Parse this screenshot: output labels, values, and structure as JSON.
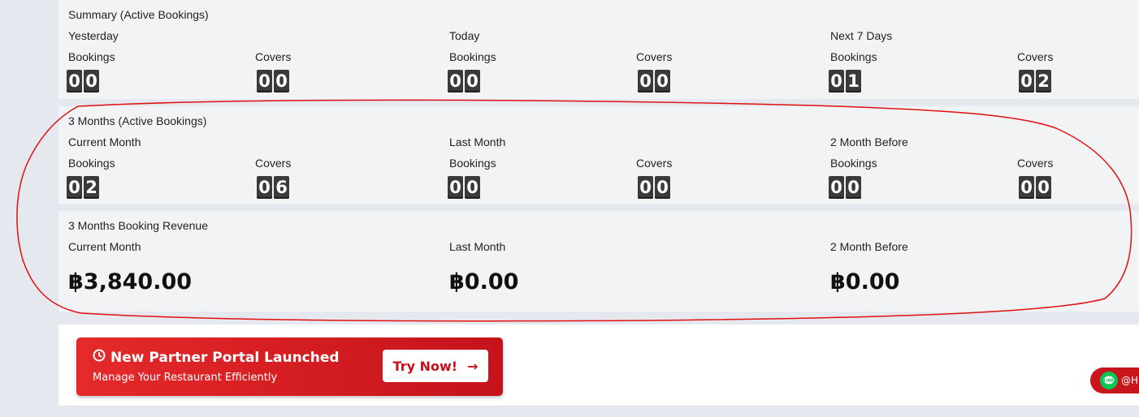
{
  "summary": {
    "title": "Summary (Active Bookings)",
    "groups": [
      {
        "label": "Yesterday",
        "bookings_label": "Bookings",
        "covers_label": "Covers",
        "bookings": [
          "0",
          "0"
        ],
        "covers": [
          "0",
          "0"
        ]
      },
      {
        "label": "Today",
        "bookings_label": "Bookings",
        "covers_label": "Covers",
        "bookings": [
          "0",
          "0"
        ],
        "covers": [
          "0",
          "0"
        ]
      },
      {
        "label": "Next 7 Days",
        "bookings_label": "Bookings",
        "covers_label": "Covers",
        "bookings": [
          "0",
          "1"
        ],
        "covers": [
          "0",
          "2"
        ]
      }
    ]
  },
  "three_months": {
    "title": "3 Months (Active Bookings)",
    "groups": [
      {
        "label": "Current Month",
        "bookings_label": "Bookings",
        "covers_label": "Covers",
        "bookings": [
          "0",
          "2"
        ],
        "covers": [
          "0",
          "6"
        ]
      },
      {
        "label": "Last Month",
        "bookings_label": "Bookings",
        "covers_label": "Covers",
        "bookings": [
          "0",
          "0"
        ],
        "covers": [
          "0",
          "0"
        ]
      },
      {
        "label": "2 Month Before",
        "bookings_label": "Bookings",
        "covers_label": "Covers",
        "bookings": [
          "0",
          "0"
        ],
        "covers": [
          "0",
          "0"
        ]
      }
    ]
  },
  "revenue": {
    "title": "3 Months Booking Revenue",
    "groups": [
      {
        "label": "Current Month",
        "amount": "฿3,840.00"
      },
      {
        "label": "Last Month",
        "amount": "฿0.00"
      },
      {
        "label": "2 Month Before",
        "amount": "฿0.00"
      }
    ]
  },
  "banner": {
    "title": "New Partner Portal Launched",
    "subtitle": "Manage Your Restaurant Efficiently",
    "button_label": "Try Now!",
    "button_arrow": "→",
    "icon": "clock-rocket-icon"
  },
  "line_chat": {
    "label": "@Hi",
    "icon": "line-icon",
    "color": "#06c755"
  },
  "colors": {
    "banner_red": "#e52a2a",
    "annotation_red": "#e01010",
    "digit_bg": "#3a3a3a"
  }
}
